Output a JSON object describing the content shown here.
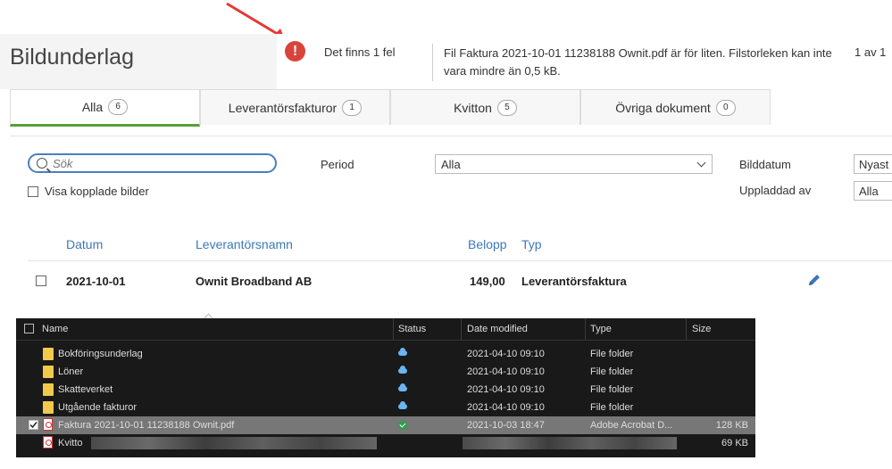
{
  "header": {
    "title": "Bildunderlag",
    "error_count": "Det finns 1 fel",
    "error_message": "Fil Faktura 2021-10-01 11238188 Ownit.pdf är för liten. Filstorleken kan inte vara mindre än 0,5 kB.",
    "error_page": "1 av 1",
    "error_icon": "!"
  },
  "tabs": [
    {
      "label": "Alla",
      "count": "6"
    },
    {
      "label": "Leverantörsfakturor",
      "count": "1"
    },
    {
      "label": "Kvitton",
      "count": "5"
    },
    {
      "label": "Övriga dokument",
      "count": "0"
    }
  ],
  "filters": {
    "search_placeholder": "Sök",
    "show_linked_label": "Visa kopplade bilder",
    "period_label": "Period",
    "period_value": "Alla",
    "image_date_label": "Bilddatum",
    "image_date_value": "Nyast f",
    "uploaded_by_label": "Uppladdad av",
    "uploaded_by_value": "Alla"
  },
  "table": {
    "columns": [
      "Datum",
      "Leverantörsnamn",
      "Belopp",
      "Typ"
    ],
    "rows": [
      {
        "date": "2021-10-01",
        "supplier": "Ownit Broadband AB",
        "amount": "149,00",
        "type": "Leverantörsfaktura"
      }
    ]
  },
  "explorer": {
    "columns": [
      "Name",
      "Status",
      "Date modified",
      "Type",
      "Size"
    ],
    "rows": [
      {
        "name": "Bokföringsunderlag",
        "date": "2021-04-10 09:10",
        "type": "File folder",
        "size": ""
      },
      {
        "name": "Löner",
        "date": "2021-04-10 09:10",
        "type": "File folder",
        "size": ""
      },
      {
        "name": "Skatteverket",
        "date": "2021-04-10 09:10",
        "type": "File folder",
        "size": ""
      },
      {
        "name": "Utgående fakturor",
        "date": "2021-04-10 09:10",
        "type": "File folder",
        "size": ""
      },
      {
        "name": "Faktura 2021-10-01 11238188 Ownit.pdf",
        "date": "2021-10-03 18:47",
        "type": "Adobe Acrobat D...",
        "size": "128 KB"
      },
      {
        "name": "Kvitto",
        "date": "",
        "type": "",
        "size": "69 KB"
      }
    ]
  },
  "colors": {
    "accent": "#5a9e3a",
    "error": "#d9443a",
    "link": "#3c78b8"
  }
}
